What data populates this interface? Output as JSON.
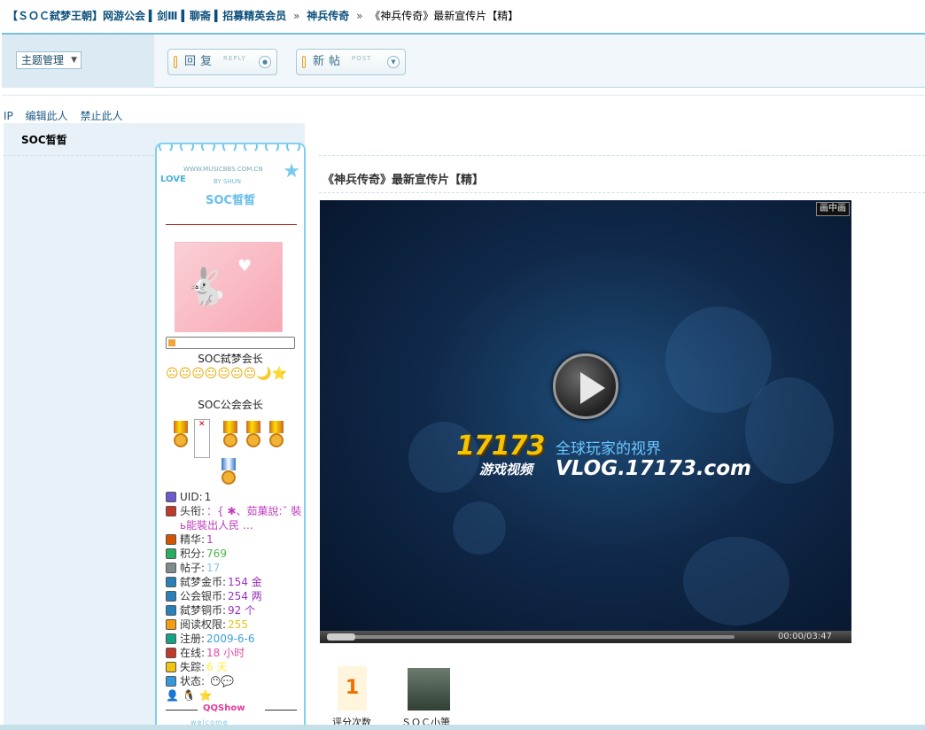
{
  "breadcrumb": {
    "forum": "【ＳＯＣ弑梦王朝】网游公会",
    "sub": "▍剑Ⅲ ▍聊斋 ▍招募精英会员",
    "sep": "»",
    "board": "神兵传奇",
    "current": "《神兵传奇》最新宣传片【精】"
  },
  "toolbar": {
    "manage": "主题管理",
    "reply": "回复",
    "reply_en": "REPLY",
    "newpost": "新帖",
    "newpost_en": "POST"
  },
  "post_ops": [
    "IP",
    "编辑此人",
    "禁止此人"
  ],
  "author": {
    "name": "SOC皙皙",
    "card_name": "SOC皙皙",
    "card_url": "WWW.MUSICBBS.COM.CN",
    "card_love": "LOVE",
    "card_by": "BY   SHUN",
    "rank1": "SOC弑梦会长",
    "smileys": "😐😐😐😐😐😐😐🌙⭐",
    "rank2": "SOC公会会长",
    "stats": [
      {
        "label": "UID:",
        "value": "1",
        "color": "#333"
      },
      {
        "label": "头衔:",
        "value": "：{ ✱、茹菓說:ˇ 裝ь能裝出人民 …",
        "color": "#c03ec0"
      },
      {
        "label": "精华:",
        "value": "1",
        "color": "#c03ec0"
      },
      {
        "label": "积分:",
        "value": "769",
        "color": "#4bb64b"
      },
      {
        "label": "帖子:",
        "value": "17",
        "color": "#8ac6e8"
      },
      {
        "label": "弑梦金币:",
        "value": "154 金",
        "color": "#9b2fc0"
      },
      {
        "label": "公会银币:",
        "value": "254 两",
        "color": "#9b2fc0"
      },
      {
        "label": "弑梦铜币:",
        "value": "92 个",
        "color": "#9b2fc0"
      },
      {
        "label": "阅读权限:",
        "value": "255",
        "color": "#e6c51a"
      },
      {
        "label": "注册:",
        "value": "2009-6-6",
        "color": "#3ba0d8"
      },
      {
        "label": "在线:",
        "value": "18 小时",
        "color": "#e64aa6"
      },
      {
        "label": "失踪:",
        "value": "6 天",
        "color": "#ffee3a"
      },
      {
        "label": "状态:",
        "value": "",
        "color": "#333"
      }
    ],
    "qqshow": "QQShow",
    "welcome": "welcome"
  },
  "post": {
    "title": "《神兵传奇》最新宣传片【精】",
    "video": {
      "pip": "画中画",
      "logo_num": "17173",
      "logo_sub": "游戏视频",
      "slogan": "全球玩家的视界",
      "url": "VLOG.17173.com",
      "time": "00:00/03:47"
    },
    "score": "1",
    "score_label": "评分次数",
    "user_label": "ＳＯＣ小箫"
  },
  "colors": {
    "accent": "#0b4f7a",
    "card_border": "#7fd0ee"
  }
}
